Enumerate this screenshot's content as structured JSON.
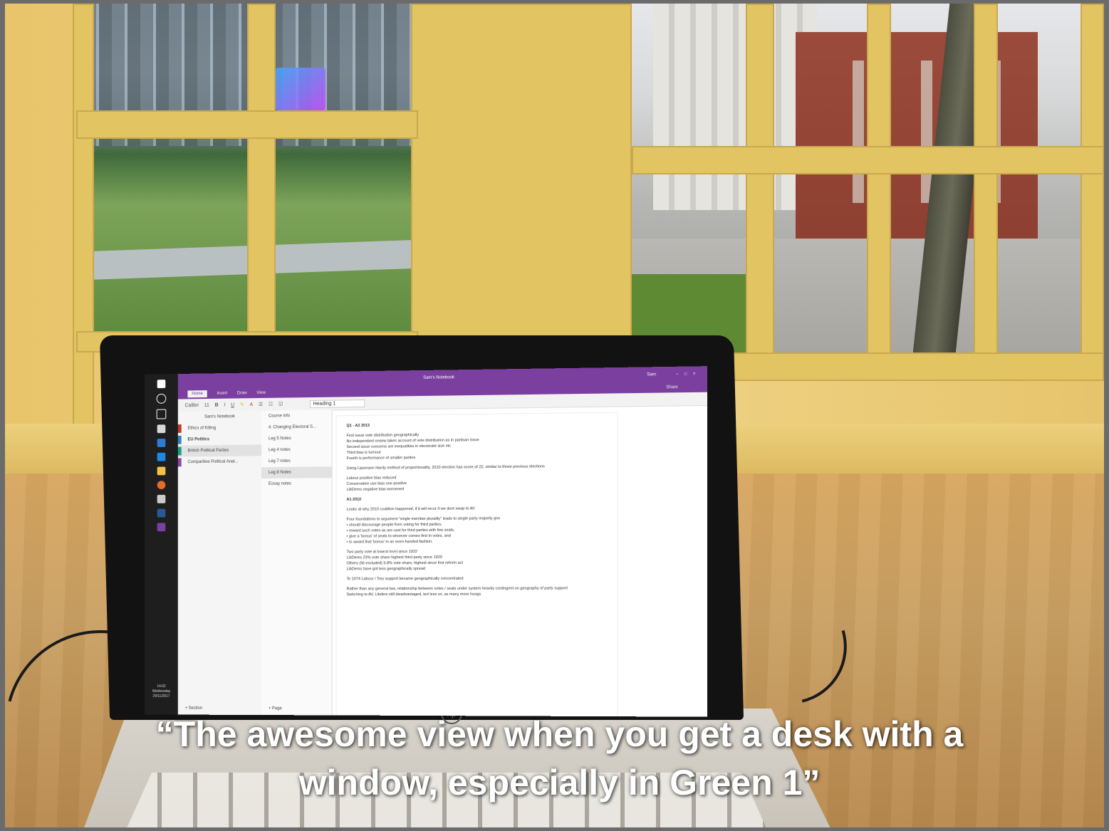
{
  "caption": {
    "line1": "“The awesome view when you get a desk with a",
    "line2": "window, especially in Green 1”"
  },
  "onenote": {
    "window_title": "Sam's Notebook",
    "tabs": [
      "Home",
      "Insert",
      "Draw",
      "View"
    ],
    "font_name": "Calibri",
    "font_size": "11",
    "style": "Heading 1",
    "share_label": "Share",
    "user": "Sam",
    "notebook_name": "Sam's Notebook",
    "sections": [
      {
        "label": "Ethics of Killing",
        "color": "#c0392b"
      },
      {
        "label": "EU Politics",
        "color": "#2e86c1"
      },
      {
        "label": "British Political Parties",
        "color": "#16a085"
      },
      {
        "label": "Comparitive Political Anal...",
        "color": "#8e44ad"
      }
    ],
    "pages": [
      "Course info",
      "4. Changing Electoral S...",
      "Leg 5 Notes",
      "Leg 4 notes",
      "Leg 7 notes",
      "Leg 8 Notes",
      "Essay notes"
    ],
    "add_section": "+ Section",
    "add_page": "+ Page",
    "note_lines": [
      "Q1 - A2 2013",
      "First issue vote distribution geographically",
      "No independent review takes account of vote distribution as in partisan issue",
      "Second issue concerns are inequalities in electorate size etc",
      "Third bias is turnout",
      "Fourth is performance of smaller parties",
      "Using Lipsmann Hardy method of proportionality, 2010 election has score of 22, similar to those previous elections",
      "Labour positive bias reduced",
      "Conservative use bias one positive",
      "LibDems negative bias worsened",
      "A1 2010",
      "Looks at why 2010 coalition happened, if it will recur if we dont swap to AV",
      "Four foundations to argument \"single member plurality\" leads to single party majority gov",
      "should discourage people from voting for third parties,",
      "reward such votes as are cast for third parties with few seats,",
      "give a 'bonus' of seats to whoever comes first in votes, and",
      "to award that 'bonus' in an even-handed fashion.",
      "Two party vote at lowest level since 1922",
      "LibDems 23% vote share highest third party since 1929",
      "Others (NI excluded) 9.8% vote share, highest since first reform act",
      "LibDems have got less geographically spread",
      "To 1974 Labour / Tory support became geographically concentrated",
      "Rather than any general law, relationship between votes / seats under system heavily contingent on geography of party support",
      "Switching to AV, Libdem still disadvantaged, but less so, as many more hungs"
    ]
  },
  "taskbar": {
    "time": "14:02",
    "day": "Wednesday",
    "date": "29/11/2017"
  },
  "laptop_brand": "hp"
}
